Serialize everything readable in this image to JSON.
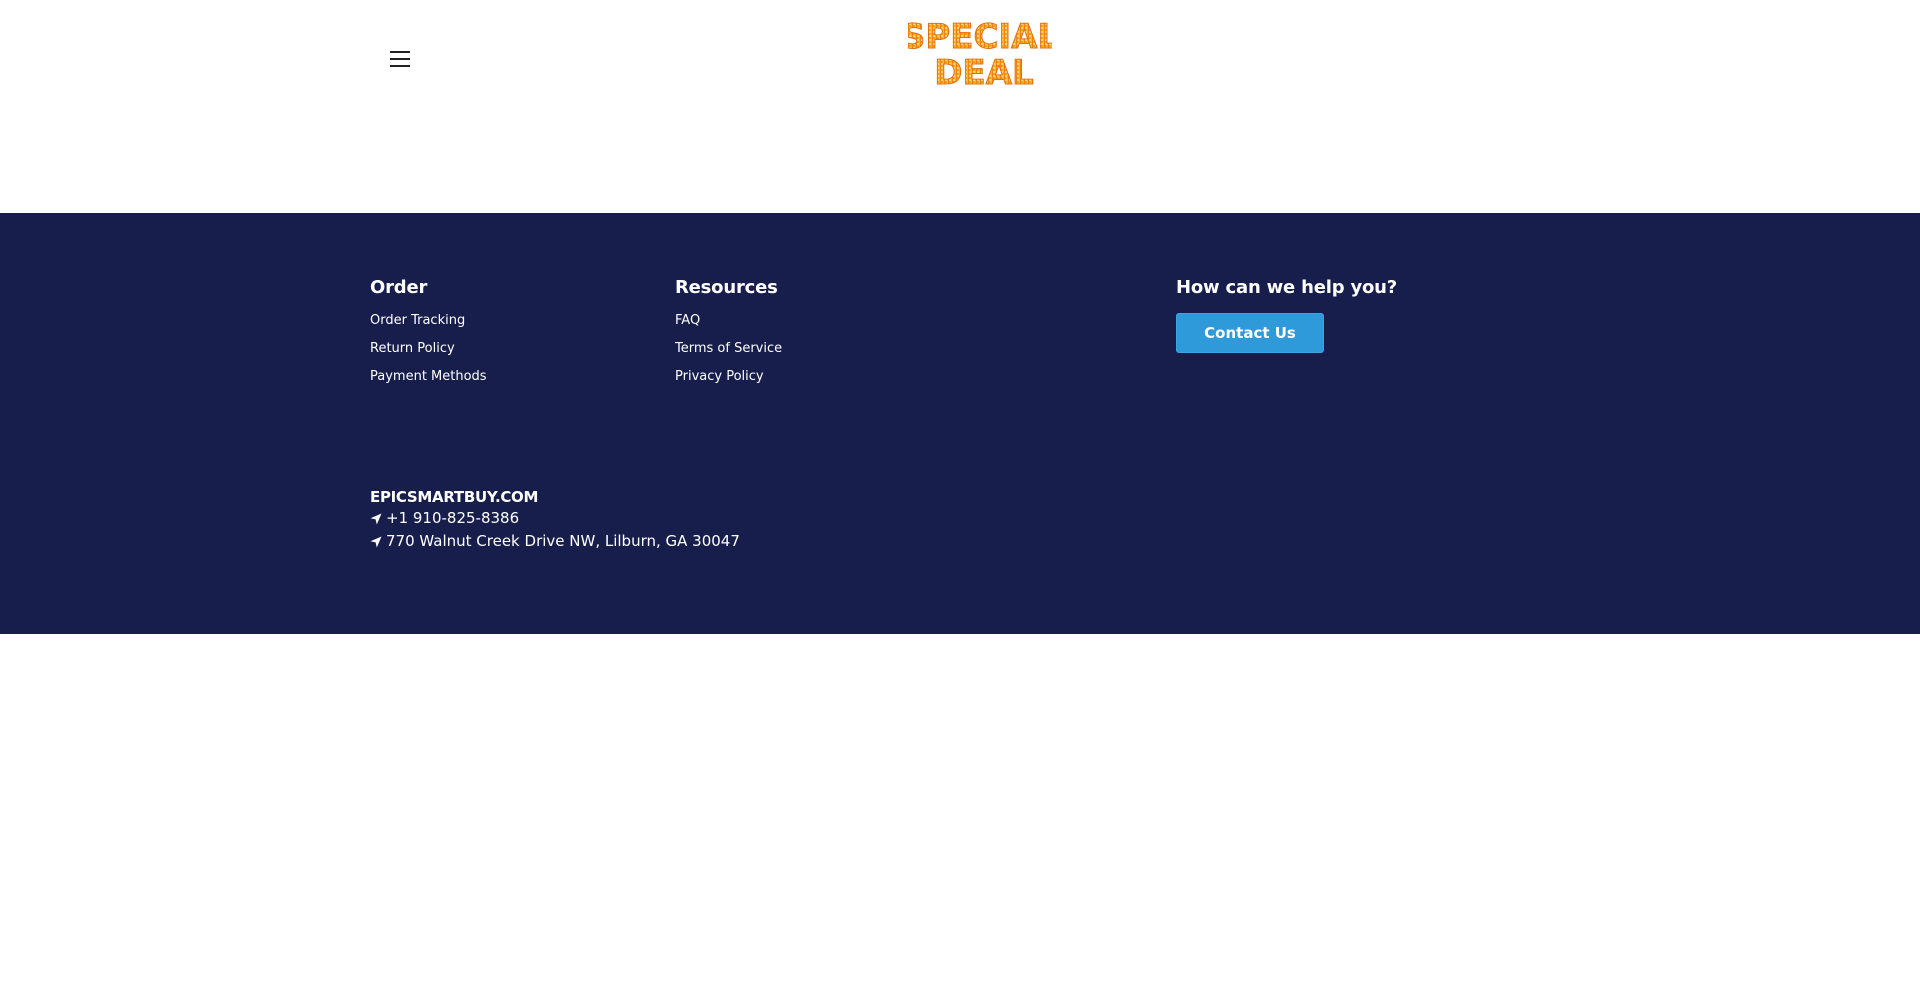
{
  "header": {
    "logo_line1": "SPECIAL",
    "logo_line2": "DEAL",
    "logo_colors": {
      "start": "#f07a12",
      "end": "#f6c21a"
    },
    "menu_icon": "hamburger-menu-icon"
  },
  "footer": {
    "background": "#171e4c",
    "order": {
      "heading": "Order",
      "links": [
        "Order Tracking",
        "Return Policy",
        "Payment Methods"
      ]
    },
    "resources": {
      "heading": "Resources",
      "links": [
        "FAQ",
        "Terms of Service",
        "Privacy Policy"
      ]
    },
    "help": {
      "heading": "How can we help you?",
      "button_label": "Contact Us",
      "button_color": "#2e9ad9"
    },
    "company": {
      "name": "EPICSMARTBUY.COM",
      "phone": "+1 910-825-8386",
      "address": "770 Walnut Creek Drive NW, Lilburn, GA 30047",
      "line_icon": "location-arrow-icon"
    }
  }
}
